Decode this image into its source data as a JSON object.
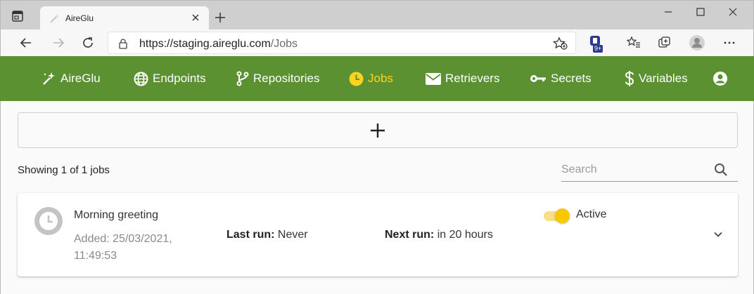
{
  "browser": {
    "tab_title": "AireGlu",
    "url_host": "https://staging.aireglu.com",
    "url_path": "/Jobs",
    "extension_badge": "9+"
  },
  "nav": {
    "brand": "AireGlu",
    "items": [
      {
        "label": "Endpoints",
        "icon": "globe-icon"
      },
      {
        "label": "Repositories",
        "icon": "git-branch-icon"
      },
      {
        "label": "Jobs",
        "icon": "clock-icon",
        "active": true
      },
      {
        "label": "Retrievers",
        "icon": "envelope-icon"
      },
      {
        "label": "Secrets",
        "icon": "key-icon"
      },
      {
        "label": "Variables",
        "icon": "dollar-icon"
      }
    ],
    "account_icon": "account-icon"
  },
  "toolbar": {
    "add_icon": "plus-icon",
    "showing": "Showing 1 of 1 jobs",
    "search_placeholder": "Search"
  },
  "jobs": [
    {
      "name": "Morning greeting",
      "added": "Added: 25/03/2021, 11:49:53",
      "last_run_label": "Last run:",
      "last_run_value": "Never",
      "next_run_label": "Next run:",
      "next_run_value": "in 20 hours",
      "status": "Active",
      "enabled": true
    }
  ],
  "colors": {
    "nav_bg": "#5c9132",
    "accent": "#ffd21e",
    "toggle_on": "#f7c800"
  }
}
